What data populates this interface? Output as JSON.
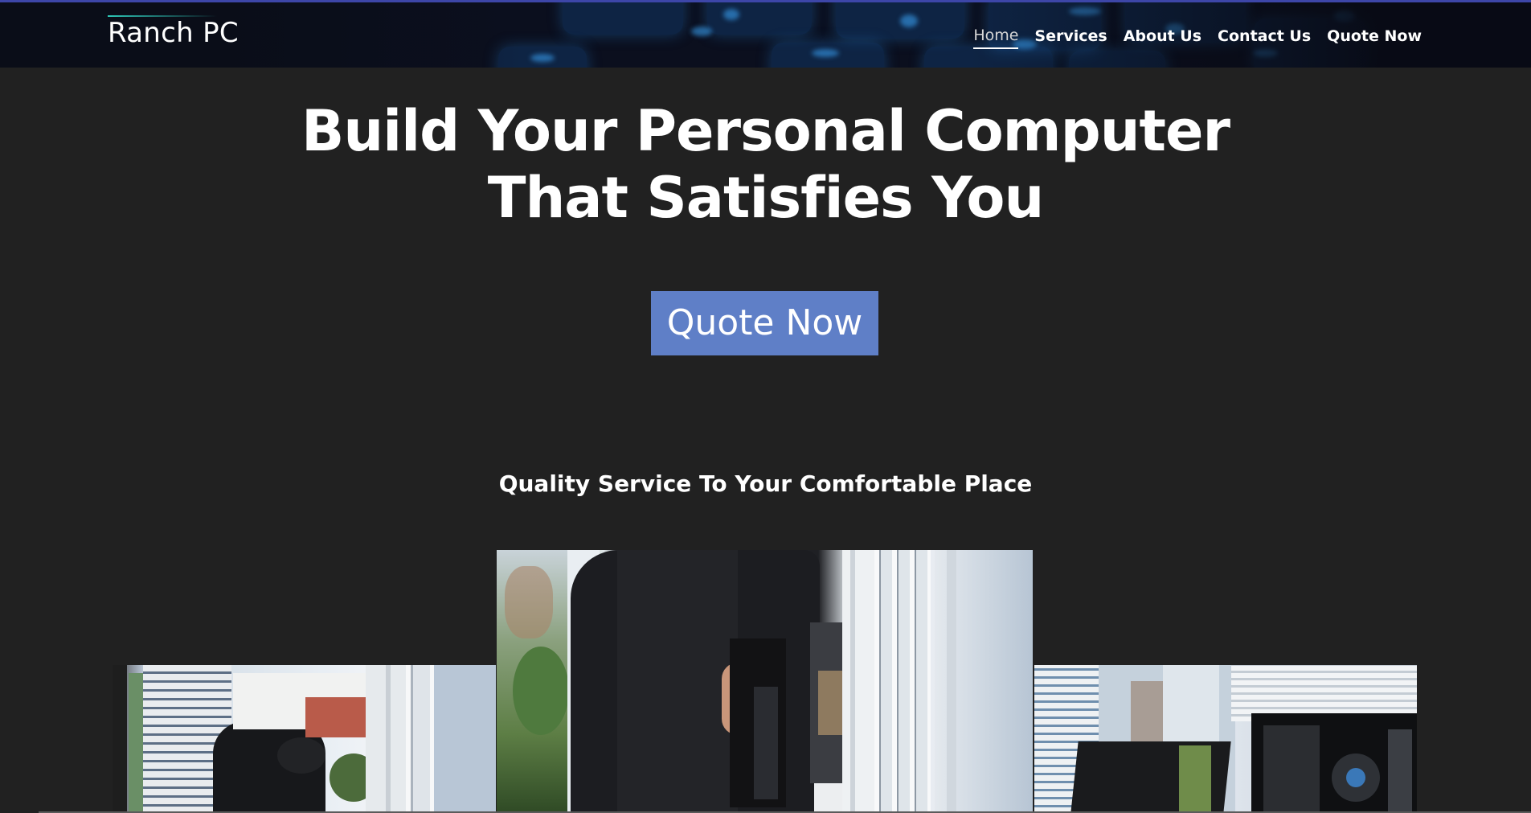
{
  "header": {
    "brand": "Ranch PC",
    "nav": [
      {
        "label": "Home",
        "active": true
      },
      {
        "label": "Services",
        "active": false
      },
      {
        "label": "About Us",
        "active": false
      },
      {
        "label": "Contact Us",
        "active": false
      },
      {
        "label": "Quote Now",
        "active": false
      }
    ]
  },
  "hero": {
    "title_line1": "Build Your Personal Computer",
    "title_line2": "That Satisfies You",
    "cta_label": "Quote Now"
  },
  "section": {
    "heading": "Quality Service To Your Comfortable Place"
  },
  "colors": {
    "background": "#212121",
    "cta": "#5f7fc7",
    "header_border": "#3d46a8"
  }
}
